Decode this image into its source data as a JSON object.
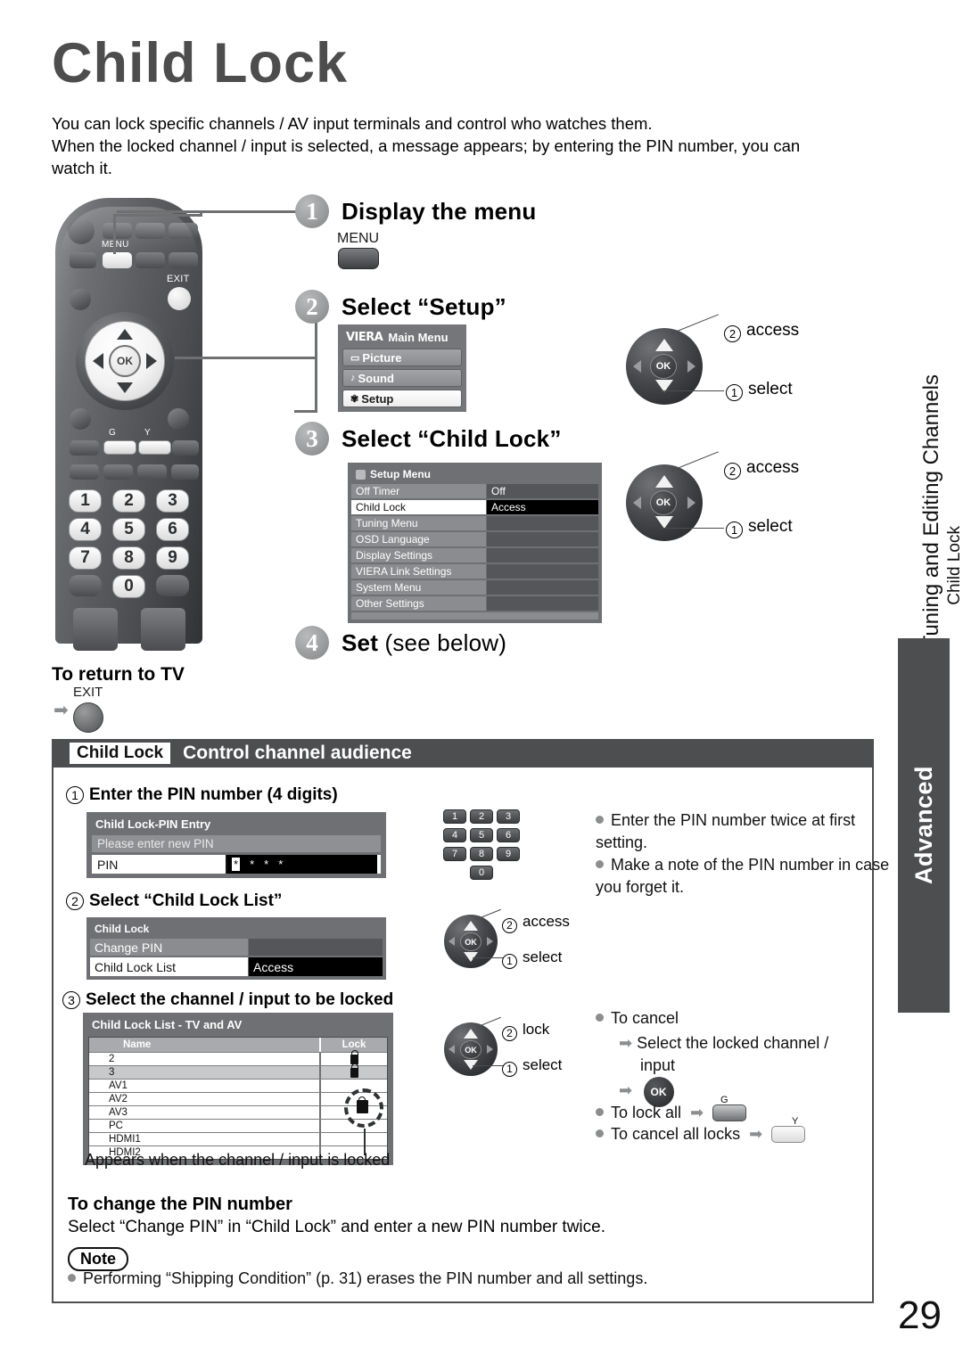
{
  "page": {
    "title": "Child Lock",
    "page_number": "29",
    "intro_line1": "You can lock specific channels / AV input terminals and control who watches them.",
    "intro_line2": "When the locked channel / input is selected, a message appears; by entering the PIN number, you can",
    "intro_line3": "watch it."
  },
  "side": {
    "vertical_main": "Tuning and Editing Channels",
    "vertical_sub": "Child Lock",
    "tab_label": "Advanced"
  },
  "remote": {
    "menu_label": "MENU",
    "exit_label": "EXIT",
    "ok_label": "OK",
    "green_label": "G",
    "yellow_label": "Y",
    "numbers": [
      "1",
      "2",
      "3",
      "4",
      "5",
      "6",
      "7",
      "8",
      "9",
      "0"
    ]
  },
  "steps": [
    {
      "num": "1",
      "title": "Display the menu",
      "key_label": "MENU"
    },
    {
      "num": "2",
      "title": "Select “Setup”"
    },
    {
      "num": "3",
      "title": "Select “Child Lock”"
    },
    {
      "num": "4",
      "title_bold": "Set",
      "title_thin": "(see below)"
    }
  ],
  "main_menu": {
    "brand": "VIERA",
    "title": "Main Menu",
    "items": [
      {
        "icon": "picture-icon",
        "label": "Picture",
        "selected": false
      },
      {
        "icon": "sound-icon",
        "label": "Sound",
        "selected": false
      },
      {
        "icon": "setup-icon",
        "label": "Setup",
        "selected": true
      }
    ]
  },
  "setup_menu": {
    "title": "Setup Menu",
    "rows": [
      {
        "name": "Off Timer",
        "value": "Off",
        "selected": false
      },
      {
        "name": "Child Lock",
        "value": "Access",
        "selected": true
      },
      {
        "name": "Tuning Menu",
        "value": "",
        "selected": false
      },
      {
        "name": "OSD Language",
        "value": "",
        "selected": false
      },
      {
        "name": "Display Settings",
        "value": "",
        "selected": false
      },
      {
        "name": "VIERA Link Settings",
        "value": "",
        "selected": false
      },
      {
        "name": "System Menu",
        "value": "",
        "selected": false
      },
      {
        "name": "Other Settings",
        "value": "",
        "selected": false
      }
    ]
  },
  "wheels": {
    "step2": {
      "access_num": "2",
      "access": "access",
      "select_num": "1",
      "select": "select",
      "ok": "OK"
    },
    "step3": {
      "access_num": "2",
      "access": "access",
      "select_num": "1",
      "select": "select",
      "ok": "OK"
    },
    "sub2": {
      "access_num": "2",
      "access": "access",
      "select_num": "1",
      "select": "select",
      "ok": "OK"
    },
    "sub3": {
      "access_num": "2",
      "access": "lock",
      "select_num": "1",
      "select": "select",
      "ok": "OK"
    }
  },
  "return_to_tv": {
    "heading": "To return to TV",
    "key_label": "EXIT"
  },
  "section": {
    "tag": "Child Lock",
    "name": "Control channel audience"
  },
  "sub1": {
    "num": "1",
    "heading": "Enter the PIN number (4 digits)",
    "osd": {
      "title": "Child Lock-PIN Entry",
      "message": "Please enter new PIN",
      "field_label": "PIN",
      "field_value": "* * * *"
    },
    "notes": [
      "Enter the PIN number twice at first setting.",
      "Make a note of the PIN number in case you forget it."
    ]
  },
  "sub2": {
    "num": "2",
    "heading": "Select “Child Lock List”",
    "osd": {
      "title": "Child Lock",
      "rows": [
        {
          "name": "Change PIN",
          "value": "",
          "selected": false
        },
        {
          "name": "Child Lock List",
          "value": "Access",
          "selected": true
        }
      ]
    }
  },
  "sub3": {
    "num": "3",
    "heading": "Select the channel / input to be locked",
    "osd": {
      "title": "Child Lock List - TV and AV",
      "columns": [
        "Name",
        "Lock"
      ],
      "rows": [
        {
          "name": "2",
          "locked": true,
          "highlight": false
        },
        {
          "name": "3",
          "locked": true,
          "highlight": true
        },
        {
          "name": "AV1",
          "locked": false,
          "highlight": false
        },
        {
          "name": "AV2",
          "locked": false,
          "highlight": false
        },
        {
          "name": "AV3",
          "locked": false,
          "highlight": false
        },
        {
          "name": "PC",
          "locked": false,
          "highlight": false
        },
        {
          "name": "HDMI1",
          "locked": false,
          "highlight": false
        },
        {
          "name": "HDMI2",
          "locked": false,
          "highlight": false
        }
      ]
    },
    "caption": "Appears when the channel / input is locked",
    "cancel": {
      "title": "To cancel",
      "line1": "Select the locked channel /",
      "line2": "input",
      "ok": "OK"
    },
    "lock_all": "To lock all",
    "lock_all_key": "G",
    "cancel_all": "To cancel all locks",
    "cancel_all_key": "Y"
  },
  "change_pin": {
    "heading": "To change the PIN number",
    "body": "Select “Change PIN” in “Child Lock” and enter a new PIN number twice."
  },
  "note": {
    "label": "Note",
    "items": [
      "Performing “Shipping Condition” (p. 31) erases the PIN number and all settings."
    ]
  },
  "colors": {
    "title_gray": "#4d4d4d",
    "panel_dark": "#4d4e50",
    "osd_gray": "#757679"
  }
}
